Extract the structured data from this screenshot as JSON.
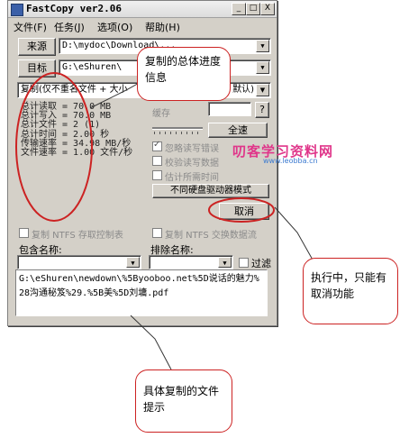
{
  "window": {
    "title": "FastCopy ver2.06",
    "controls": {
      "minimize": "_",
      "maximize": "□",
      "close": "X"
    }
  },
  "menu": [
    "文件(F)",
    "任务(J)",
    "选项(O)",
    "帮助(H)"
  ],
  "source": {
    "button_label": "来源",
    "path": "D:\\mydoc\\Download\\..."
  },
  "dest": {
    "button_label": "目标",
    "path": "G:\\eShuren\\"
  },
  "mode": {
    "selected": "复制(仅不重名文件 + 大小",
    "suffix": "默认)"
  },
  "stats": {
    "lines": [
      "总计读取 = 70.0 MB",
      "总计写入 = 70.0 MB",
      "总计文件 = 2 (1)",
      "总计时间 = 2.00 秒",
      "传输速率 = 34.98 MB/秒",
      "文件速率 = 1.00 文件/秒"
    ]
  },
  "options": {
    "buffer_label": "缓存",
    "help_button": "?",
    "verify_all_button": "全速",
    "ignore_errors": "忽略读写错误",
    "verify": "校验读写数据",
    "estimate": "估计所需时间",
    "diff_drive": "不同硬盘驱动器模式"
  },
  "cancel_button": "取消",
  "acl": {
    "ntfs_acl": "复制 NTFS 存取控制表",
    "ntfs_stream": "复制 NTFS 交换数据流"
  },
  "filters": {
    "include_label": "包含名称:",
    "exclude_label": "排除名称:",
    "filter_label": "过滤"
  },
  "current_file": "G:\\eShuren\\newdown\\%5Byooboo.net%5D说话的魅力%28沟通秘笈%29.%5B美%5D刘墉.pdf",
  "annotations": {
    "progress": "复制的总体进度信息",
    "cancel": "执行中，只能有取消功能",
    "file": "具体复制的文件提示"
  },
  "watermark": {
    "title": "叨客学习资料网",
    "url": "www.leobba.cn"
  },
  "colors": {
    "annotation_red": "#cc2222",
    "window_face": "#d4d0c8"
  }
}
